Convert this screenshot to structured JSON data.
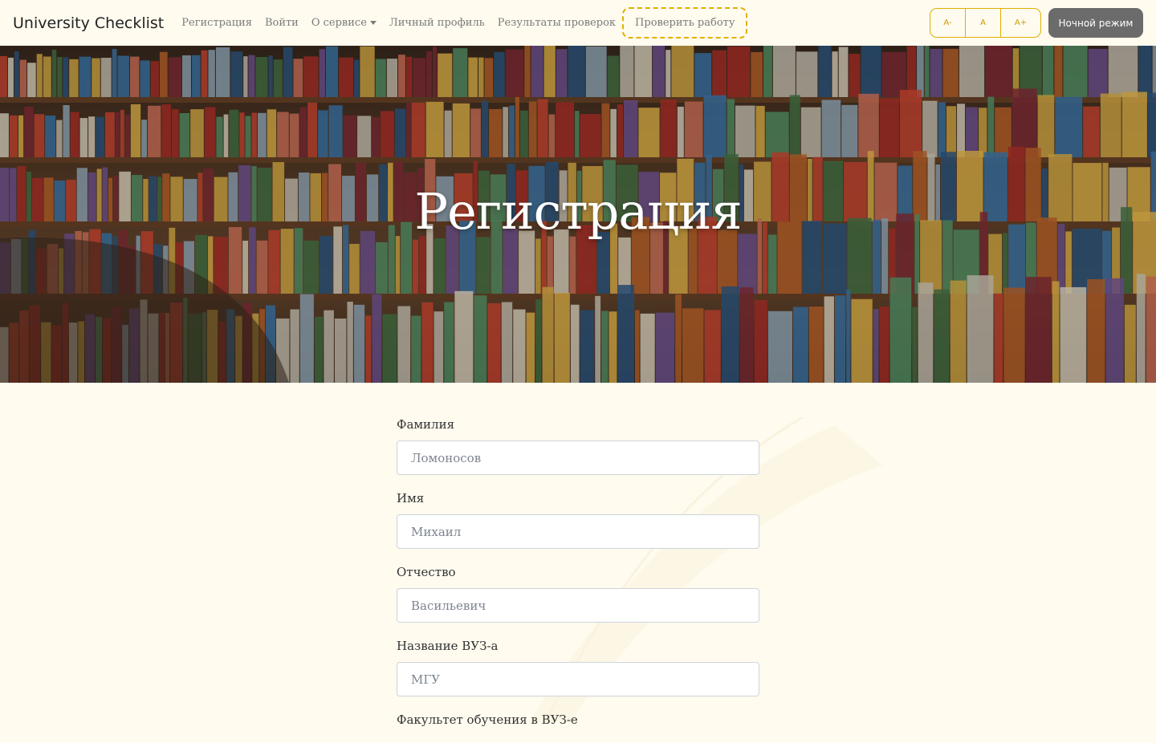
{
  "navbar": {
    "brand": "University Checklist",
    "links": [
      "Регистрация",
      "Войти",
      "О сервисе",
      "Личный профиль",
      "Результаты проверок"
    ],
    "check_button": "Проверить работу",
    "font_buttons": [
      "A-",
      "A",
      "A+"
    ],
    "night_mode": "Ночной режим"
  },
  "hero": {
    "title": "Регистрация"
  },
  "form": {
    "fields": [
      {
        "label": "Фамилия",
        "placeholder": "Ломоносов",
        "value": ""
      },
      {
        "label": "Имя",
        "placeholder": "Михаил",
        "value": ""
      },
      {
        "label": "Отчество",
        "placeholder": "Васильевич",
        "value": ""
      },
      {
        "label": "Название ВУЗ-а",
        "placeholder": "МГУ",
        "value": ""
      },
      {
        "label": "Факультет обучения в ВУЗ-е",
        "placeholder": "",
        "value": ""
      }
    ]
  },
  "colors": {
    "page_bg": "#fffbef",
    "accent": "#e0b000",
    "night_button": "#6b6b6b"
  }
}
